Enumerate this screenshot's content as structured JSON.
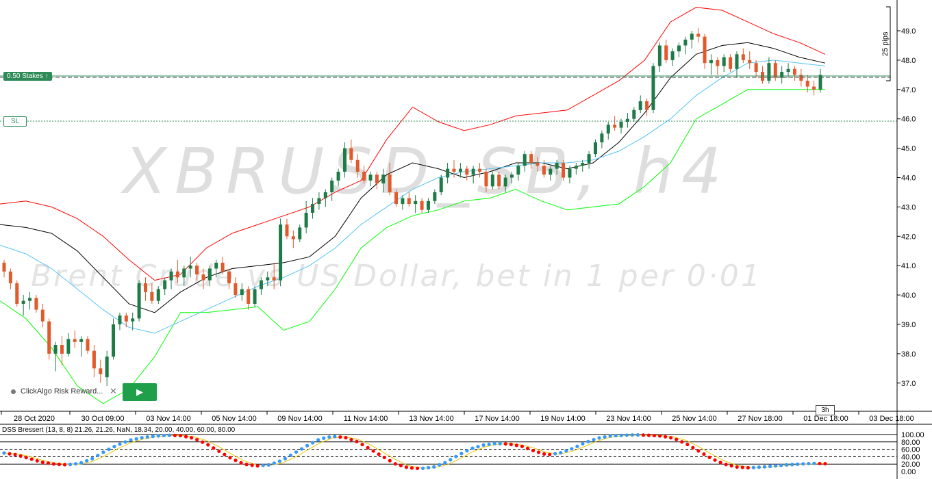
{
  "chart": {
    "symbol_watermark": "XBRUSD_SB, h4",
    "description_watermark": "Brent Crude vs US Dollar, bet in 1 per 0·01",
    "stake_tag": "0.50 Stakes",
    "sl_tag": "SL",
    "pips_label": "25 pips",
    "period_tag": "3h",
    "price_axis_labels": [
      "49.0",
      "48.0",
      "47.0",
      "46.0",
      "45.0",
      "44.0",
      "43.0",
      "42.0",
      "41.0",
      "40.0",
      "39.0",
      "38.0",
      "37.0"
    ],
    "time_axis_labels": [
      "28 Oct 2020",
      "30 Oct 09:00",
      "03 Nov 14:00",
      "05 Nov 14:00",
      "09 Nov 14:00",
      "11 Nov 14:00",
      "13 Nov 14:00",
      "17 Nov 14:00",
      "19 Nov 14:00",
      "23 Nov 14:00",
      "25 Nov 14:00",
      "27 Nov 18:00",
      "01 Dec 18:00",
      "03 Dec 18:00"
    ]
  },
  "widget": {
    "label": "ClickAlgo Risk Reward...",
    "close_symbol": "✕",
    "play_symbol": "▶"
  },
  "oscillator": {
    "title": "DSS Bressert (13, 8, 8) 21.26, 21.26, NaN, 18.34, 20.00, 40.00, 60.00, 80.00",
    "axis_labels": [
      "100.00",
      "80.00",
      "60.00",
      "40.00",
      "20.00",
      "0.00"
    ]
  },
  "colors": {
    "bull": "#1e7a46",
    "bear": "#e05a2b",
    "band_upper": "#ff0000",
    "band_lower": "#00ff00",
    "band_mid": "#000000",
    "ma": "#4fc3f7",
    "dot_up": "#3399ff",
    "dot_down": "#ff0000"
  },
  "chart_data": {
    "type": "candlestick",
    "title": "XBRUSD_SB, h4",
    "ylim": [
      36.2,
      49.8
    ],
    "y_ticks": [
      37,
      38,
      39,
      40,
      41,
      42,
      43,
      44,
      45,
      46,
      47,
      48,
      49
    ],
    "current_price": 47.45,
    "stop_loss_price": 45.9,
    "candles_ohlc": [
      [
        41.1,
        41.2,
        40.6,
        40.8
      ],
      [
        40.8,
        40.9,
        40.2,
        40.4
      ],
      [
        40.4,
        40.5,
        39.6,
        39.7
      ],
      [
        39.7,
        40.0,
        39.3,
        39.8
      ],
      [
        39.8,
        40.1,
        39.5,
        39.9
      ],
      [
        39.9,
        40.0,
        39.4,
        39.5
      ],
      [
        39.5,
        39.7,
        38.9,
        39.1
      ],
      [
        39.1,
        39.2,
        37.8,
        38.0
      ],
      [
        38.0,
        38.4,
        37.4,
        38.3
      ],
      [
        38.3,
        38.6,
        37.6,
        38.0
      ],
      [
        38.0,
        38.7,
        37.9,
        38.5
      ],
      [
        38.5,
        38.8,
        38.2,
        38.4
      ],
      [
        38.4,
        38.6,
        37.9,
        38.5
      ],
      [
        38.5,
        38.6,
        38.0,
        38.1
      ],
      [
        38.1,
        38.3,
        37.2,
        37.5
      ],
      [
        37.5,
        37.8,
        37.0,
        37.3
      ],
      [
        37.2,
        38.1,
        36.9,
        37.9
      ],
      [
        37.9,
        39.2,
        37.8,
        39.0
      ],
      [
        39.0,
        39.4,
        38.8,
        39.3
      ],
      [
        39.3,
        39.4,
        38.9,
        39.1
      ],
      [
        39.1,
        39.4,
        38.8,
        39.2
      ],
      [
        39.2,
        40.5,
        39.1,
        40.4
      ],
      [
        40.4,
        40.6,
        39.8,
        40.1
      ],
      [
        40.1,
        40.4,
        39.7,
        39.8
      ],
      [
        39.8,
        40.3,
        39.7,
        40.2
      ],
      [
        40.2,
        40.6,
        40.0,
        40.5
      ],
      [
        40.5,
        40.9,
        40.2,
        40.8
      ],
      [
        40.8,
        41.2,
        40.4,
        40.6
      ],
      [
        40.6,
        41.0,
        40.3,
        40.9
      ],
      [
        40.9,
        41.3,
        40.6,
        41.0
      ],
      [
        41.0,
        41.1,
        40.5,
        40.7
      ],
      [
        40.7,
        40.9,
        40.2,
        40.5
      ],
      [
        40.5,
        41.0,
        40.3,
        40.9
      ],
      [
        40.9,
        41.2,
        40.6,
        41.1
      ],
      [
        41.1,
        41.3,
        40.7,
        40.8
      ],
      [
        40.8,
        40.9,
        40.2,
        40.4
      ],
      [
        40.4,
        40.6,
        39.9,
        40.0
      ],
      [
        40.0,
        40.4,
        39.8,
        40.2
      ],
      [
        40.2,
        40.3,
        39.5,
        39.7
      ],
      [
        39.7,
        40.3,
        39.6,
        40.2
      ],
      [
        40.2,
        40.6,
        40.0,
        40.5
      ],
      [
        40.5,
        40.8,
        40.3,
        40.6
      ],
      [
        40.6,
        41.1,
        40.2,
        40.5
      ],
      [
        40.5,
        42.6,
        40.3,
        42.4
      ],
      [
        42.4,
        42.6,
        41.9,
        42.0
      ],
      [
        42.0,
        42.2,
        41.6,
        41.9
      ],
      [
        41.9,
        42.4,
        41.8,
        42.3
      ],
      [
        42.3,
        43.2,
        42.1,
        42.8
      ],
      [
        42.8,
        43.3,
        42.6,
        43.1
      ],
      [
        43.1,
        43.5,
        42.9,
        43.3
      ],
      [
        43.3,
        43.6,
        43.0,
        43.5
      ],
      [
        43.5,
        44.0,
        43.2,
        43.9
      ],
      [
        43.9,
        44.3,
        43.7,
        44.2
      ],
      [
        44.2,
        45.2,
        44.0,
        45.0
      ],
      [
        45.0,
        45.3,
        44.5,
        44.6
      ],
      [
        44.6,
        44.8,
        44.0,
        44.2
      ],
      [
        44.2,
        44.4,
        43.8,
        43.9
      ],
      [
        43.9,
        44.2,
        43.7,
        44.1
      ],
      [
        44.1,
        44.2,
        43.6,
        43.8
      ],
      [
        43.8,
        44.3,
        43.5,
        44.1
      ],
      [
        44.1,
        44.5,
        43.4,
        43.5
      ],
      [
        43.5,
        43.6,
        43.0,
        43.1
      ],
      [
        43.1,
        43.4,
        42.9,
        43.3
      ],
      [
        43.3,
        43.5,
        43.0,
        43.1
      ],
      [
        43.1,
        43.4,
        42.8,
        43.2
      ],
      [
        43.2,
        43.3,
        42.8,
        42.9
      ],
      [
        42.9,
        43.3,
        42.8,
        43.2
      ],
      [
        43.2,
        43.6,
        43.1,
        43.5
      ],
      [
        43.5,
        44.1,
        43.4,
        44.0
      ],
      [
        44.0,
        44.5,
        43.8,
        44.3
      ],
      [
        44.3,
        44.6,
        44.0,
        44.2
      ],
      [
        44.2,
        44.5,
        44.0,
        44.3
      ],
      [
        44.3,
        44.4,
        43.9,
        44.1
      ],
      [
        44.1,
        44.4,
        43.8,
        44.3
      ],
      [
        44.3,
        44.5,
        44.0,
        44.2
      ],
      [
        44.2,
        44.3,
        43.5,
        43.7
      ],
      [
        43.7,
        44.2,
        43.6,
        44.1
      ],
      [
        44.1,
        44.2,
        43.6,
        43.7
      ],
      [
        43.7,
        44.1,
        43.5,
        44.0
      ],
      [
        44.0,
        44.2,
        43.8,
        44.1
      ],
      [
        44.1,
        44.5,
        43.9,
        44.4
      ],
      [
        44.4,
        44.9,
        44.2,
        44.8
      ],
      [
        44.8,
        44.9,
        44.3,
        44.5
      ],
      [
        44.5,
        44.7,
        44.2,
        44.4
      ],
      [
        44.4,
        44.6,
        44.0,
        44.1
      ],
      [
        44.1,
        44.4,
        43.9,
        44.3
      ],
      [
        44.3,
        44.6,
        44.1,
        44.5
      ],
      [
        44.5,
        44.6,
        43.9,
        44.0
      ],
      [
        44.0,
        44.4,
        43.8,
        44.3
      ],
      [
        44.3,
        44.5,
        44.1,
        44.4
      ],
      [
        44.4,
        44.6,
        44.2,
        44.5
      ],
      [
        44.5,
        44.9,
        44.3,
        44.8
      ],
      [
        44.8,
        45.3,
        44.7,
        45.2
      ],
      [
        45.2,
        45.6,
        45.0,
        45.5
      ],
      [
        45.5,
        45.9,
        45.3,
        45.8
      ],
      [
        45.8,
        46.1,
        45.6,
        45.7
      ],
      [
        45.7,
        46.0,
        45.5,
        45.9
      ],
      [
        45.9,
        46.2,
        45.7,
        46.0
      ],
      [
        46.0,
        46.4,
        45.9,
        46.3
      ],
      [
        46.3,
        46.8,
        46.2,
        46.6
      ],
      [
        46.6,
        46.7,
        46.1,
        46.3
      ],
      [
        46.3,
        47.9,
        46.2,
        47.8
      ],
      [
        47.8,
        48.6,
        47.6,
        48.5
      ],
      [
        48.5,
        48.7,
        47.9,
        48.0
      ],
      [
        48.0,
        48.4,
        47.8,
        48.3
      ],
      [
        48.3,
        48.6,
        48.1,
        48.5
      ],
      [
        48.5,
        48.8,
        48.2,
        48.7
      ],
      [
        48.7,
        49.0,
        48.4,
        48.9
      ],
      [
        48.9,
        49.1,
        48.6,
        48.8
      ],
      [
        48.8,
        48.9,
        47.7,
        47.9
      ],
      [
        47.9,
        48.2,
        47.5,
        48.0
      ],
      [
        48.0,
        48.1,
        47.5,
        47.8
      ],
      [
        47.8,
        48.2,
        47.6,
        48.1
      ],
      [
        48.1,
        48.2,
        47.6,
        47.7
      ],
      [
        47.7,
        48.3,
        47.4,
        48.2
      ],
      [
        48.2,
        48.4,
        47.9,
        48.0
      ],
      [
        48.0,
        48.3,
        47.7,
        47.9
      ],
      [
        47.9,
        48.0,
        47.4,
        47.6
      ],
      [
        47.6,
        47.8,
        47.2,
        47.3
      ],
      [
        47.3,
        48.1,
        47.2,
        47.9
      ],
      [
        47.9,
        48.0,
        47.3,
        47.4
      ],
      [
        47.4,
        47.8,
        47.2,
        47.6
      ],
      [
        47.6,
        47.9,
        47.4,
        47.7
      ],
      [
        47.7,
        47.8,
        47.3,
        47.5
      ],
      [
        47.5,
        47.7,
        47.1,
        47.3
      ],
      [
        47.3,
        47.5,
        46.9,
        47.1
      ],
      [
        47.1,
        47.3,
        46.8,
        47.0
      ],
      [
        47.0,
        47.7,
        46.9,
        47.5
      ]
    ],
    "bollinger_upper": [
      43.1,
      43.2,
      43.0,
      42.6,
      42.0,
      41.2,
      40.5,
      40.7,
      41.6,
      42.1,
      42.4,
      42.7,
      43.0,
      43.5,
      43.9,
      45.3,
      46.4,
      45.9,
      45.6,
      45.8,
      46.1,
      46.2,
      46.3,
      46.8,
      47.3,
      48.0,
      49.3,
      49.8,
      49.7,
      49.3,
      48.9,
      48.6,
      48.2
    ],
    "bollinger_middle": [
      42.4,
      42.3,
      42.1,
      41.5,
      40.6,
      39.7,
      39.4,
      40.1,
      40.6,
      40.9,
      41.0,
      41.1,
      41.3,
      42.0,
      43.3,
      44.1,
      44.5,
      44.3,
      44.0,
      44.2,
      44.5,
      44.5,
      44.3,
      44.5,
      45.2,
      46.2,
      47.4,
      48.2,
      48.5,
      48.6,
      48.4,
      48.1,
      47.9
    ],
    "bollinger_lower": [
      39.8,
      39.2,
      38.2,
      36.9,
      36.3,
      36.8,
      37.9,
      39.4,
      39.4,
      39.5,
      39.6,
      38.8,
      39.1,
      40.2,
      41.6,
      42.3,
      42.7,
      42.9,
      43.2,
      43.3,
      43.6,
      43.2,
      42.9,
      43.0,
      43.1,
      43.7,
      44.5,
      46.0,
      46.5,
      47.0,
      47.0,
      47.0,
      47.0
    ],
    "ma_line": [
      41.7,
      41.4,
      40.9,
      40.2,
      39.5,
      38.9,
      38.7,
      39.1,
      39.5,
      39.9,
      40.3,
      40.6,
      41.0,
      41.6,
      42.4,
      43.0,
      43.6,
      44.0,
      44.2,
      44.3,
      44.4,
      44.5,
      44.5,
      44.6,
      44.9,
      45.4,
      46.0,
      46.8,
      47.4,
      47.9,
      48.0,
      47.9,
      47.8
    ],
    "oscillator": {
      "ylim": [
        0,
        100
      ],
      "levels": [
        20,
        40,
        60,
        80
      ],
      "signal": [
        50,
        45,
        35,
        25,
        20,
        18,
        22,
        35,
        55,
        72,
        85,
        92,
        96,
        98,
        97,
        90,
        75,
        55,
        35,
        20,
        15,
        18,
        30,
        50,
        70,
        88,
        95,
        92,
        80,
        60,
        40,
        20,
        10,
        8,
        12,
        25,
        45,
        62,
        72,
        76,
        74,
        68,
        55,
        45,
        50,
        62,
        78,
        90,
        96,
        98,
        99,
        98,
        96,
        90,
        75,
        55,
        35,
        20,
        12,
        10,
        12,
        15,
        18,
        20,
        22,
        21
      ]
    }
  }
}
